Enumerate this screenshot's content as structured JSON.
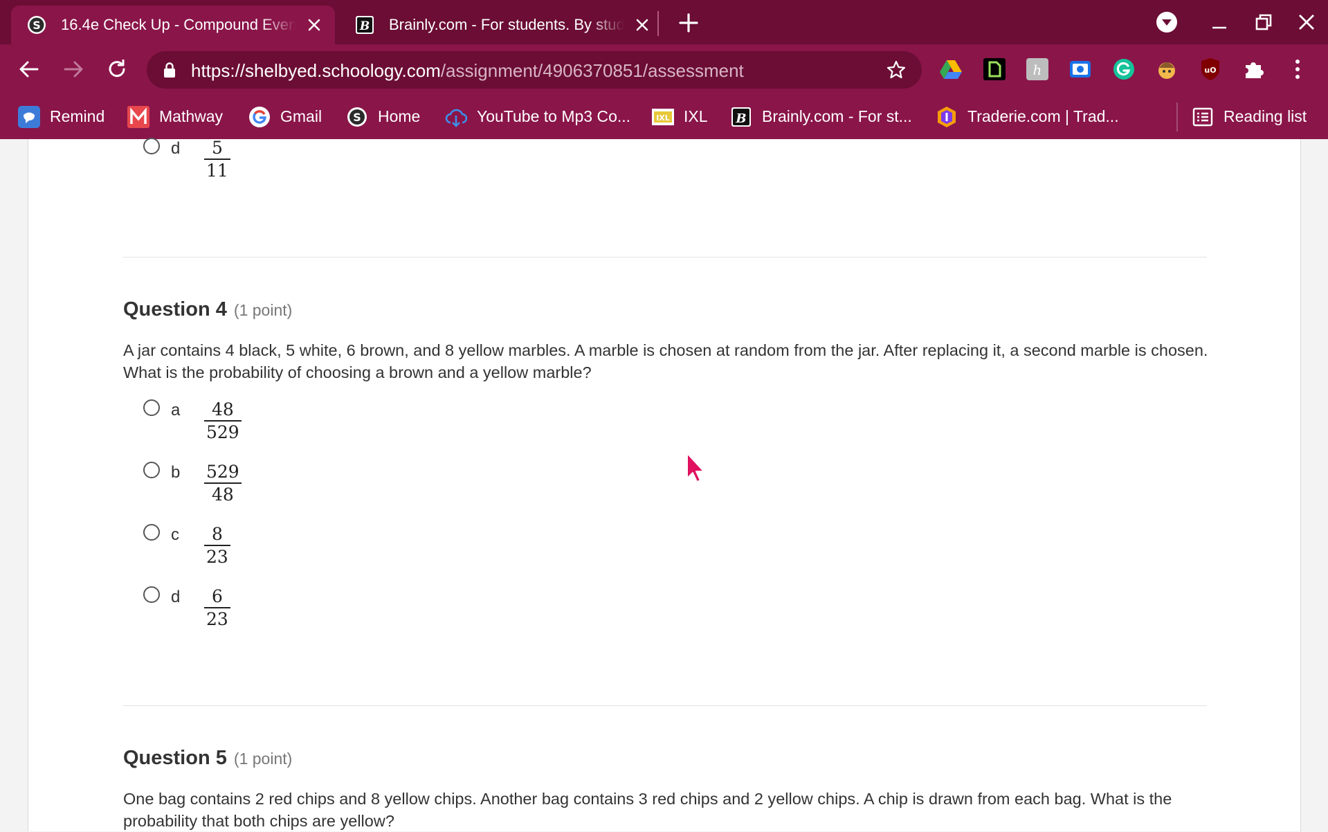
{
  "tabs": [
    {
      "title": "16.4e Check Up - Compound Events",
      "favicon": "schoology-icon",
      "active": true
    },
    {
      "title": "Brainly.com - For students. By students",
      "favicon": "brainly-icon",
      "active": false
    }
  ],
  "address": {
    "host": "https://shelbyed.schoology.com",
    "path": "/assignment/4906370851/assessment"
  },
  "bookmarks": [
    {
      "label": "Remind",
      "icon": "remind-icon"
    },
    {
      "label": "Mathway",
      "icon": "mathway-icon"
    },
    {
      "label": "Gmail",
      "icon": "google-icon"
    },
    {
      "label": "Home",
      "icon": "schoology-icon"
    },
    {
      "label": "YouTube to Mp3 Co...",
      "icon": "download-cloud-icon"
    },
    {
      "label": "IXL",
      "icon": "ixl-icon"
    },
    {
      "label": "Brainly.com - For st...",
      "icon": "brainly-icon"
    },
    {
      "label": "Traderie.com | Trad...",
      "icon": "traderie-icon"
    }
  ],
  "reading_list": "Reading list",
  "prev_question": {
    "option_d": {
      "letter": "d",
      "num": "5",
      "den": "11"
    }
  },
  "question4": {
    "label": "Question 4",
    "points": "(1 point)",
    "text": "A jar contains 4 black, 5 white, 6 brown, and 8 yellow marbles. A marble is chosen at random from the jar. After replacing it, a second marble is chosen. What is the probability of choosing a brown and a yellow marble?",
    "options": [
      {
        "letter": "a",
        "num": "48",
        "den": "529"
      },
      {
        "letter": "b",
        "num": "529",
        "den": "48"
      },
      {
        "letter": "c",
        "num": "8",
        "den": "23"
      },
      {
        "letter": "d",
        "num": "6",
        "den": "23"
      }
    ]
  },
  "question5": {
    "label": "Question 5",
    "points": "(1 point)",
    "text": "One bag contains 2 red chips and 8 yellow chips. Another bag contains 3 red chips and 2 yellow chips. A chip is drawn from each bag. What is the probability that both chips are yellow?"
  },
  "colors": {
    "chrome_dark": "#6b0d34",
    "chrome": "#8a1549",
    "cursor": "#e0115f"
  }
}
